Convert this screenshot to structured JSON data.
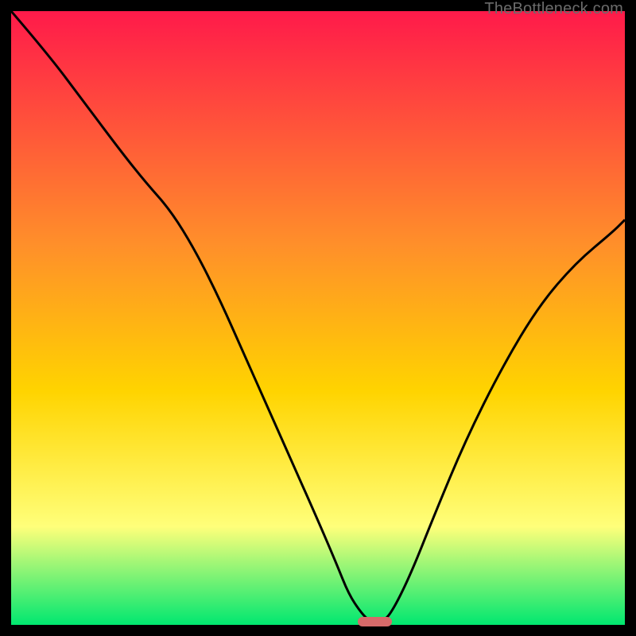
{
  "watermark": "TheBottleneck.com",
  "colors": {
    "gradient_top": "#ff1a4a",
    "gradient_mid1": "#ff8f2a",
    "gradient_mid2": "#ffd400",
    "gradient_mid3": "#ffff7a",
    "gradient_bottom": "#00e770",
    "line": "#000000",
    "frame": "#000000",
    "marker": "#d66a6a"
  },
  "chart_data": {
    "type": "line",
    "title": "",
    "xlabel": "",
    "ylabel": "",
    "xlim": [
      0,
      100
    ],
    "ylim": [
      0,
      100
    ],
    "series": [
      {
        "name": "bottleneck-curve",
        "x": [
          0,
          6,
          12,
          18,
          22,
          26,
          30,
          34,
          38,
          42,
          46,
          50,
          53,
          55,
          57,
          58.5,
          60.5,
          62,
          65,
          69,
          74,
          80,
          86,
          92,
          98,
          100
        ],
        "y": [
          100,
          93,
          85,
          77,
          72,
          67.5,
          61,
          53,
          44,
          35,
          26,
          17,
          10,
          5,
          2,
          0.5,
          0.5,
          2,
          8,
          18,
          30,
          42,
          52,
          59,
          64,
          66
        ]
      }
    ],
    "marker": {
      "x_start": 56.5,
      "x_end": 62,
      "y": 0.5
    }
  }
}
